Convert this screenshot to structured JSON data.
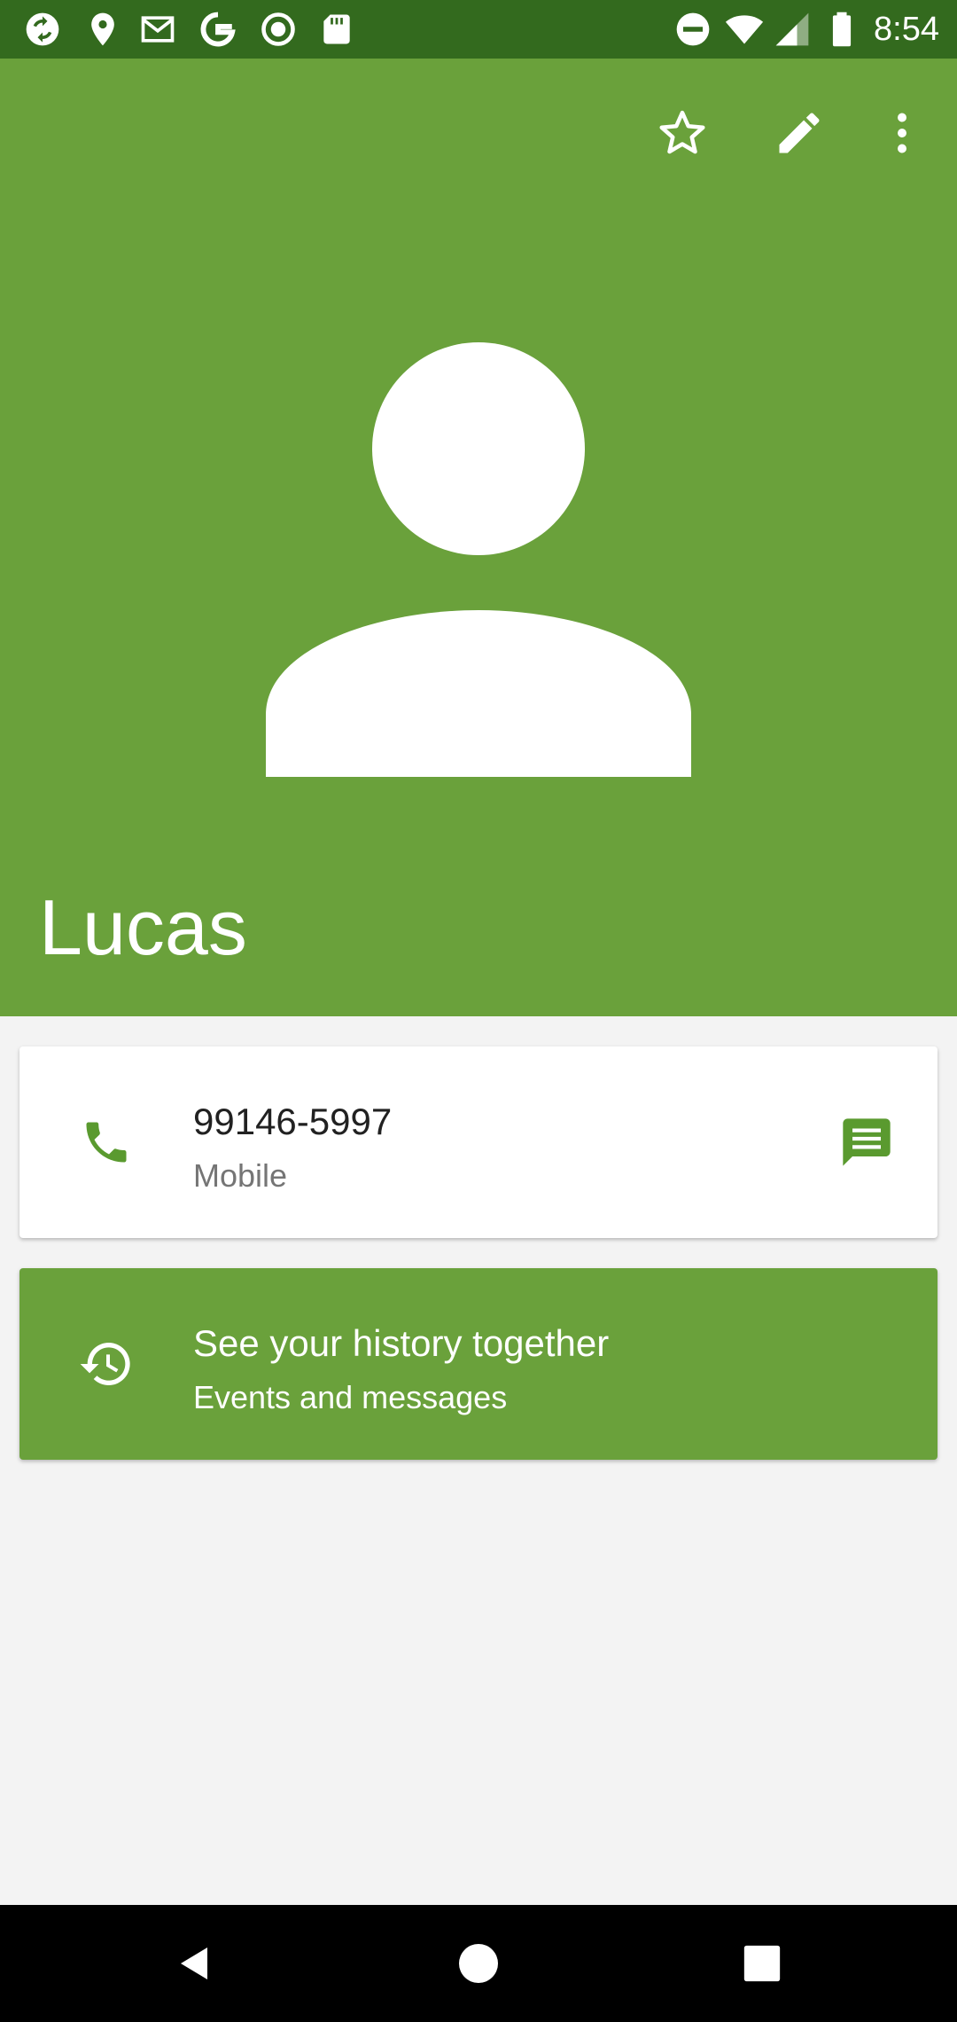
{
  "status_bar": {
    "time": "8:54",
    "icons_left": [
      "sync-icon",
      "location-icon",
      "gmail-icon",
      "google-icon",
      "record-icon",
      "sd-card-icon"
    ],
    "icons_right": [
      "do-not-disturb-icon",
      "wifi-icon",
      "signal-icon",
      "battery-icon"
    ]
  },
  "toolbar": {
    "actions": [
      "star-icon",
      "edit-icon",
      "more-vert-icon"
    ]
  },
  "contact": {
    "name": "Lucas",
    "phone": {
      "number": "99146-5997",
      "type": "Mobile"
    },
    "history": {
      "title": "See your history together",
      "subtitle": "Events and messages"
    }
  },
  "colors": {
    "status_bar": "#336a1e",
    "primary": "#6aa13b",
    "background": "#f3f3f3",
    "card": "#ffffff",
    "nav_bar": "#000000"
  },
  "nav_bar": {
    "buttons": [
      "back-icon",
      "home-icon",
      "recents-icon"
    ]
  }
}
